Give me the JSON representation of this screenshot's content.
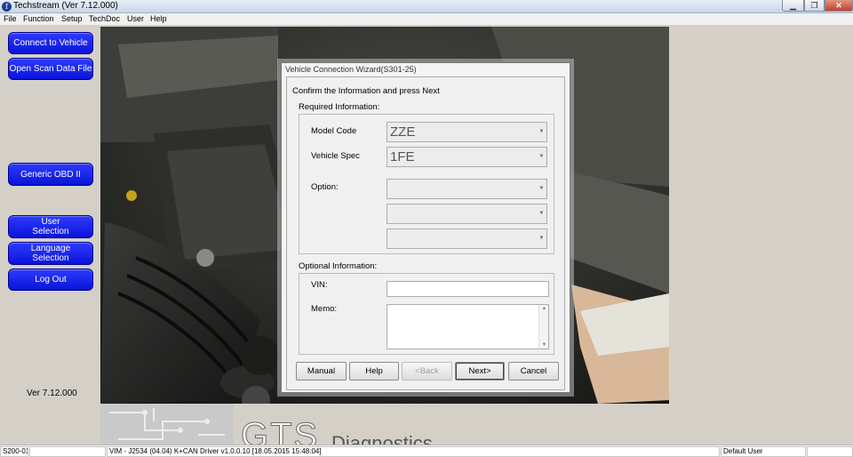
{
  "window": {
    "title": "Techstream (Ver 7.12.000)",
    "app_icon_glyph": "f"
  },
  "window_controls": {
    "minimize": "▁",
    "maximize": "❐",
    "close": "✕"
  },
  "menu": [
    "File",
    "Function",
    "Setup",
    "TechDoc",
    "User",
    "Help"
  ],
  "sidebar": {
    "connect": "Connect to Vehicle",
    "open_scan": "Open Scan Data File",
    "generic_obd": "Generic OBD II",
    "user_selection_1": "User",
    "user_selection_2": "Selection",
    "language_selection_1": "Language",
    "language_selection_2": "Selection",
    "log_out": "Log Out",
    "version": "Ver 7.12.000"
  },
  "background": {
    "brand": "GTS",
    "brand_sub": "Diagnostics"
  },
  "dialog": {
    "title": "Vehicle Connection Wizard(S301-25)",
    "prompt": "Confirm the Information and press Next",
    "required_label": "Required Information:",
    "model_code_label": "Model Code",
    "model_code_value": "ZZE",
    "vehicle_spec_label": "Vehicle Spec",
    "vehicle_spec_value": "1FE",
    "option_label": "Option:",
    "option_values": [
      "",
      "",
      ""
    ],
    "optional_label": "Optional Information:",
    "vin_label": "VIN:",
    "vin_value": "",
    "memo_label": "Memo:",
    "memo_value": "",
    "buttons": {
      "manual": "Manual",
      "help": "Help",
      "back": "<Back",
      "next": "Next>",
      "cancel": "Cancel"
    }
  },
  "statusbar": {
    "code": "S200-01",
    "driver": "VIM - J2534 (04.04) K+CAN Driver v1.0.0.10 [18.05.2015 15:48:04]",
    "user": "Default User"
  },
  "colors": {
    "nav_button": "#0a14d8",
    "title_bar": "#c9d6e6",
    "close_button": "#c13f27"
  }
}
